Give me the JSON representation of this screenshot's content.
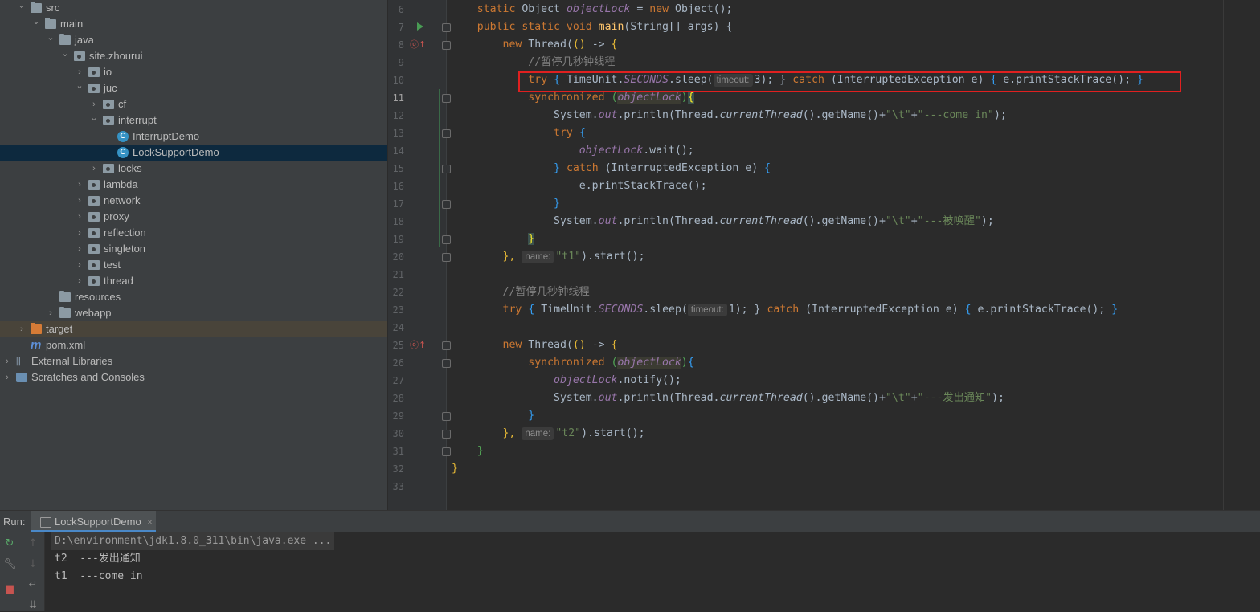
{
  "project_tree": [
    {
      "label": "src",
      "depth": 1,
      "kind": "folder",
      "expanded": true
    },
    {
      "label": "main",
      "depth": 2,
      "kind": "folder",
      "expanded": true
    },
    {
      "label": "java",
      "depth": 3,
      "kind": "folder-src",
      "expanded": true
    },
    {
      "label": "site.zhourui",
      "depth": 4,
      "kind": "package",
      "expanded": true
    },
    {
      "label": "io",
      "depth": 5,
      "kind": "package",
      "expanded": false
    },
    {
      "label": "juc",
      "depth": 5,
      "kind": "package",
      "expanded": true
    },
    {
      "label": "cf",
      "depth": 6,
      "kind": "package",
      "expanded": false
    },
    {
      "label": "interrupt",
      "depth": 6,
      "kind": "package",
      "expanded": true
    },
    {
      "label": "InterruptDemo",
      "depth": 7,
      "kind": "class"
    },
    {
      "label": "LockSupportDemo",
      "depth": 7,
      "kind": "class",
      "selected": true
    },
    {
      "label": "locks",
      "depth": 6,
      "kind": "package",
      "expanded": false
    },
    {
      "label": "lambda",
      "depth": 5,
      "kind": "package",
      "expanded": false
    },
    {
      "label": "network",
      "depth": 5,
      "kind": "package",
      "expanded": false
    },
    {
      "label": "proxy",
      "depth": 5,
      "kind": "package",
      "expanded": false
    },
    {
      "label": "reflection",
      "depth": 5,
      "kind": "package",
      "expanded": false
    },
    {
      "label": "singleton",
      "depth": 5,
      "kind": "package",
      "expanded": false
    },
    {
      "label": "test",
      "depth": 5,
      "kind": "package",
      "expanded": false
    },
    {
      "label": "thread",
      "depth": 5,
      "kind": "package",
      "expanded": false
    },
    {
      "label": "resources",
      "depth": 3,
      "kind": "folder",
      "leaf": true
    },
    {
      "label": "webapp",
      "depth": 3,
      "kind": "folder",
      "expanded": false
    },
    {
      "label": "target",
      "depth": 1,
      "kind": "target",
      "expanded": false,
      "highlight": true
    },
    {
      "label": "pom.xml",
      "depth": 1,
      "kind": "maven",
      "leaf": true
    },
    {
      "label": "External Libraries",
      "depth": 0,
      "kind": "libraries",
      "expanded": false
    },
    {
      "label": "Scratches and Consoles",
      "depth": 0,
      "kind": "scratches",
      "expanded": false
    }
  ],
  "editor": {
    "line_numbers": [
      "6",
      "7",
      "8",
      "9",
      "10",
      "11",
      "12",
      "13",
      "14",
      "15",
      "16",
      "17",
      "18",
      "19",
      "20",
      "21",
      "22",
      "23",
      "24",
      "25",
      "26",
      "27",
      "28",
      "29",
      "30",
      "31",
      "32",
      "33"
    ],
    "current_line": "11",
    "lines": {
      "l6": [
        "static",
        "Object",
        "objectLock",
        "=",
        "new",
        "Object();"
      ],
      "l7": [
        "public static void",
        "main",
        "(String[] args) {"
      ],
      "l8": [
        "new",
        "Thread(",
        "()",
        " -> ",
        "{"
      ],
      "l9": "//暂停几秒钟线程",
      "l10": {
        "try": "try",
        "open": "{",
        "call": "TimeUnit.",
        "field": "SECONDS",
        "sleep": ".sleep(",
        "hint": "timeout:",
        "arg": "3",
        "close": "); }",
        "catch": "catch",
        "exc": "(InterruptedException e)",
        "body": "e.printStackTrace();",
        "end": "}"
      },
      "l11": [
        "synchronized",
        "objectLock",
        "{"
      ],
      "l12": {
        "a": "System.",
        "b": "out",
        "c": ".println(Thread.",
        "d": "currentThread",
        "e": "().getName()+",
        "s1": "\"\\t\"",
        "plus": "+",
        "s2": "\"---come in\"",
        "end": ");"
      },
      "l13": [
        "try",
        "{"
      ],
      "l14": [
        "objectLock",
        ".wait();"
      ],
      "l15": [
        "}",
        "catch",
        "(InterruptedException e)",
        "{"
      ],
      "l16": "e.printStackTrace();",
      "l17": "}",
      "l18": {
        "a": "System.",
        "b": "out",
        "c": ".println(Thread.",
        "d": "currentThread",
        "e": "().getName()+",
        "s1": "\"\\t\"",
        "plus": "+",
        "s2": "\"---被唤醒\"",
        "end": ");"
      },
      "l19": "}",
      "l20": {
        "a": "},",
        "hint": "name:",
        "s": "\"t1\"",
        "end": ").start();"
      },
      "l22": "//暂停几秒钟线程",
      "l23": {
        "try": "try",
        "open": "{",
        "call": "TimeUnit.",
        "field": "SECONDS",
        "sleep": ".sleep(",
        "hint": "timeout:",
        "arg": "1",
        "close": "); }",
        "catch": "catch",
        "exc": "(InterruptedException e)",
        "body": "e.printStackTrace();",
        "end": "}"
      },
      "l25": [
        "new",
        "Thread(",
        "()",
        " -> ",
        "{"
      ],
      "l26": [
        "synchronized",
        "objectLock",
        "{"
      ],
      "l27": [
        "objectLock",
        ".notify();"
      ],
      "l28": {
        "a": "System.",
        "b": "out",
        "c": ".println(Thread.",
        "d": "currentThread",
        "e": "().getName()+",
        "s1": "\"\\t\"",
        "plus": "+",
        "s2": "\"---发出通知\"",
        "end": ");"
      },
      "l29": "}",
      "l30": {
        "a": "},",
        "hint": "name:",
        "s": "\"t2\"",
        "end": ").start();"
      },
      "l31": "}",
      "l32": "}"
    }
  },
  "run_panel": {
    "label": "Run:",
    "tab": "LockSupportDemo",
    "tab_close": "×",
    "console": [
      "D:\\environment\\jdk1.8.0_311\\bin\\java.exe ...",
      "t2  ---发出通知",
      "t1  ---come in"
    ]
  },
  "colors": {
    "keyword": "#cc7832",
    "field": "#9876aa",
    "method": "#ffc66d",
    "string": "#6a8759",
    "comment": "#808080",
    "highlight_box": "#e02020"
  }
}
